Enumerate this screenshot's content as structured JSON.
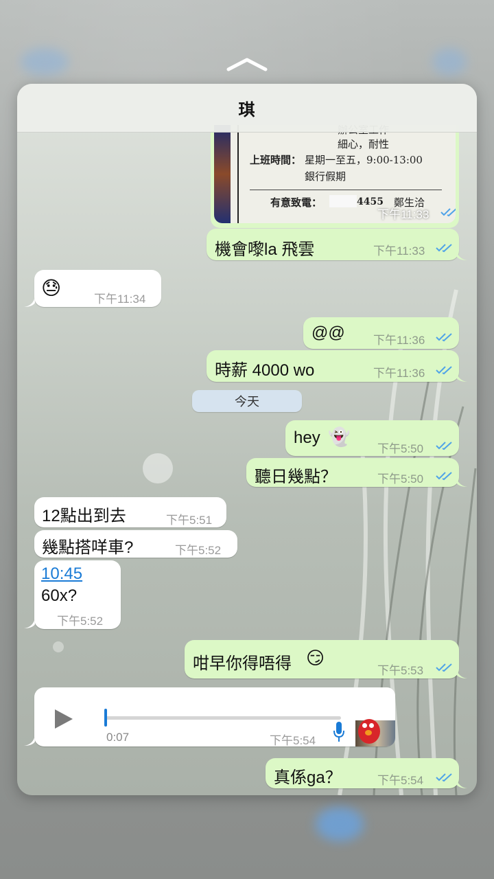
{
  "chat": {
    "title": "琪"
  },
  "photo_message": {
    "doc_lines": [
      "辦公室工作",
      "細心，耐性",
      "上班時間：",
      "星期一至五，9:00-13:00",
      "銀行假期",
      "有意致電：",
      "4455",
      "鄭生洽"
    ],
    "time": "下午11:33"
  },
  "messages": {
    "m1": {
      "text": "機會嚟la 飛雲",
      "time": "下午11:33"
    },
    "m2": {
      "emoji": "😓",
      "time": "下午11:34"
    },
    "m3": {
      "text": "@@",
      "time": "下午11:36"
    },
    "m4": {
      "text": "時薪 4000 wo",
      "time": "下午11:36"
    },
    "date_separator": "今天",
    "m5": {
      "text": "hey",
      "emoji": "👻",
      "time": "下午5:50"
    },
    "m6": {
      "text": "聽日幾點？",
      "time": "下午5:50"
    },
    "m7": {
      "text": "12點出到去",
      "time": "下午5:51"
    },
    "m8": {
      "text": "幾點搭咩車?",
      "time": "下午5:52"
    },
    "m9": {
      "link": "10:45",
      "text": "60x?",
      "time": "下午5:52"
    },
    "m10": {
      "text": "咁早你得唔得",
      "emoji": "😏",
      "time": "下午5:53"
    },
    "voice": {
      "duration": "0:07",
      "time": "下午5:54",
      "progress": 0.0
    },
    "m11": {
      "text": "真係ga？",
      "time": "下午5:54"
    }
  },
  "colors": {
    "outgoing_bubble": "#dcf8c6",
    "incoming_bubble": "#ffffff",
    "read_ticks": "#4fa3e8",
    "date_pill": "#d6e3ef",
    "link": "#1a7bd6"
  }
}
